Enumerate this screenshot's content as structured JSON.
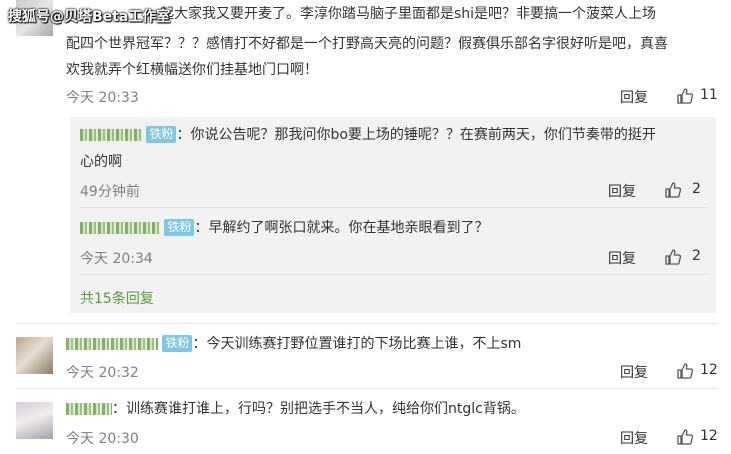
{
  "watermark": "搜狐号@贝塔Beta工作室",
  "top_comment": {
    "text_line1": "起大家我又要开麦了。李淳你踏马脑子里面都是shi是吧？非要搞一个菠菜人上场",
    "text_line2": "配四个世界冠军？？？感情打不好都是一个打野高天亮的问题？假赛俱乐部名字很好听是吧，真喜",
    "text_line3": "欢我就弄个红横幅送你们挂基地门口啊！",
    "time": "今天 20:33",
    "reply_label": "回复",
    "likes": "11"
  },
  "replies": [
    {
      "badge": "铁粉",
      "text_line1": "：你说公告呢？那我问你bo要上场的锤呢？？在赛前两天，你们节奏带的挺开",
      "text_line2": "心的啊",
      "time": "49分钟前",
      "reply_label": "回复",
      "likes": "2"
    },
    {
      "badge": "铁粉",
      "text_line1": "：早解约了啊张口就来。你在基地亲眼看到了？",
      "time": "今天 20:34",
      "reply_label": "回复",
      "likes": "2"
    }
  ],
  "more_replies": "共15条回复",
  "comments": [
    {
      "badge": "铁粉",
      "text": "：今天训练赛打野位置谁打的下场比赛上谁，不上sm",
      "time": "今天 20:32",
      "reply_label": "回复",
      "likes": "12"
    },
    {
      "text": "：训练赛谁打谁上，行吗？别把选手不当人，纯给你们ntglc背锅。",
      "time": "今天 20:30",
      "reply_label": "回复",
      "likes": "12"
    }
  ],
  "colors": {
    "username_green": "#5c9a3a",
    "badge_blue": "#7ec8e3",
    "panel_bg": "#f2f2f2",
    "time_gray": "#808080"
  },
  "icons": [
    "thumbs-up-icon"
  ]
}
